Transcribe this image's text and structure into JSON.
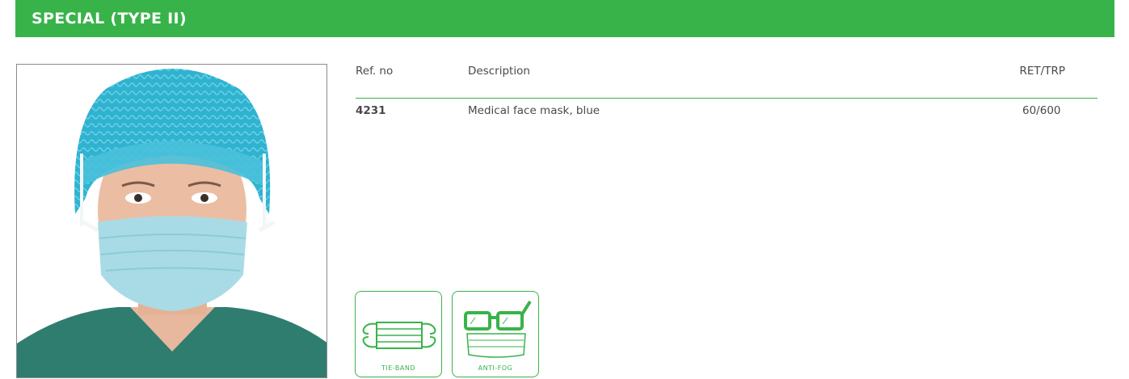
{
  "header": {
    "title": "SPECIAL (TYPE II)"
  },
  "colors": {
    "brand_green": "#38b34a",
    "mask_blue": "#a9dbe6",
    "cap_blue": "#2fb3d1",
    "scrubs": "#2f7d6f"
  },
  "table": {
    "columns": {
      "ref": "Ref. no",
      "description": "Description",
      "ret_trp": "RET/TRP"
    },
    "rows": [
      {
        "ref": "4231",
        "description": "Medical face mask, blue",
        "ret_trp": "60/600"
      }
    ]
  },
  "features": [
    {
      "label": "TIE-BAND",
      "icon": "tie-band-mask-icon"
    },
    {
      "label": "ANTI-FOG",
      "icon": "anti-fog-glasses-icon"
    }
  ]
}
